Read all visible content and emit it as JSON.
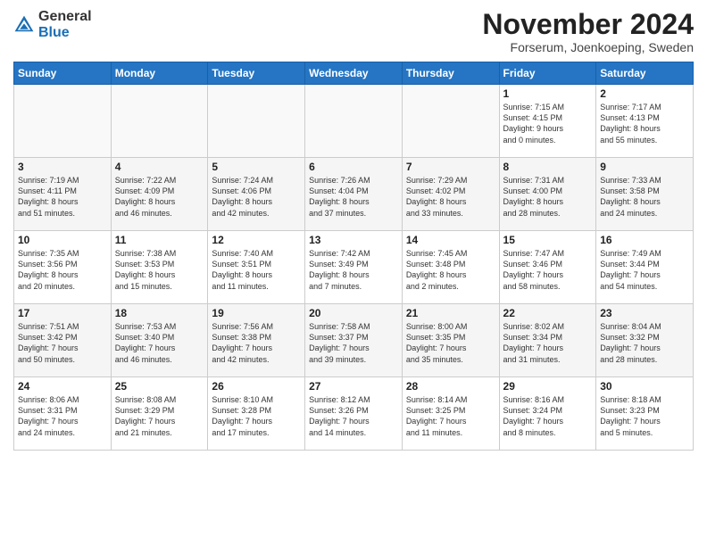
{
  "header": {
    "logo_general": "General",
    "logo_blue": "Blue",
    "month_title": "November 2024",
    "location": "Forserum, Joenkoeping, Sweden"
  },
  "days_of_week": [
    "Sunday",
    "Monday",
    "Tuesday",
    "Wednesday",
    "Thursday",
    "Friday",
    "Saturday"
  ],
  "weeks": [
    [
      {
        "day": "",
        "info": ""
      },
      {
        "day": "",
        "info": ""
      },
      {
        "day": "",
        "info": ""
      },
      {
        "day": "",
        "info": ""
      },
      {
        "day": "",
        "info": ""
      },
      {
        "day": "1",
        "info": "Sunrise: 7:15 AM\nSunset: 4:15 PM\nDaylight: 9 hours\nand 0 minutes."
      },
      {
        "day": "2",
        "info": "Sunrise: 7:17 AM\nSunset: 4:13 PM\nDaylight: 8 hours\nand 55 minutes."
      }
    ],
    [
      {
        "day": "3",
        "info": "Sunrise: 7:19 AM\nSunset: 4:11 PM\nDaylight: 8 hours\nand 51 minutes."
      },
      {
        "day": "4",
        "info": "Sunrise: 7:22 AM\nSunset: 4:09 PM\nDaylight: 8 hours\nand 46 minutes."
      },
      {
        "day": "5",
        "info": "Sunrise: 7:24 AM\nSunset: 4:06 PM\nDaylight: 8 hours\nand 42 minutes."
      },
      {
        "day": "6",
        "info": "Sunrise: 7:26 AM\nSunset: 4:04 PM\nDaylight: 8 hours\nand 37 minutes."
      },
      {
        "day": "7",
        "info": "Sunrise: 7:29 AM\nSunset: 4:02 PM\nDaylight: 8 hours\nand 33 minutes."
      },
      {
        "day": "8",
        "info": "Sunrise: 7:31 AM\nSunset: 4:00 PM\nDaylight: 8 hours\nand 28 minutes."
      },
      {
        "day": "9",
        "info": "Sunrise: 7:33 AM\nSunset: 3:58 PM\nDaylight: 8 hours\nand 24 minutes."
      }
    ],
    [
      {
        "day": "10",
        "info": "Sunrise: 7:35 AM\nSunset: 3:56 PM\nDaylight: 8 hours\nand 20 minutes."
      },
      {
        "day": "11",
        "info": "Sunrise: 7:38 AM\nSunset: 3:53 PM\nDaylight: 8 hours\nand 15 minutes."
      },
      {
        "day": "12",
        "info": "Sunrise: 7:40 AM\nSunset: 3:51 PM\nDaylight: 8 hours\nand 11 minutes."
      },
      {
        "day": "13",
        "info": "Sunrise: 7:42 AM\nSunset: 3:49 PM\nDaylight: 8 hours\nand 7 minutes."
      },
      {
        "day": "14",
        "info": "Sunrise: 7:45 AM\nSunset: 3:48 PM\nDaylight: 8 hours\nand 2 minutes."
      },
      {
        "day": "15",
        "info": "Sunrise: 7:47 AM\nSunset: 3:46 PM\nDaylight: 7 hours\nand 58 minutes."
      },
      {
        "day": "16",
        "info": "Sunrise: 7:49 AM\nSunset: 3:44 PM\nDaylight: 7 hours\nand 54 minutes."
      }
    ],
    [
      {
        "day": "17",
        "info": "Sunrise: 7:51 AM\nSunset: 3:42 PM\nDaylight: 7 hours\nand 50 minutes."
      },
      {
        "day": "18",
        "info": "Sunrise: 7:53 AM\nSunset: 3:40 PM\nDaylight: 7 hours\nand 46 minutes."
      },
      {
        "day": "19",
        "info": "Sunrise: 7:56 AM\nSunset: 3:38 PM\nDaylight: 7 hours\nand 42 minutes."
      },
      {
        "day": "20",
        "info": "Sunrise: 7:58 AM\nSunset: 3:37 PM\nDaylight: 7 hours\nand 39 minutes."
      },
      {
        "day": "21",
        "info": "Sunrise: 8:00 AM\nSunset: 3:35 PM\nDaylight: 7 hours\nand 35 minutes."
      },
      {
        "day": "22",
        "info": "Sunrise: 8:02 AM\nSunset: 3:34 PM\nDaylight: 7 hours\nand 31 minutes."
      },
      {
        "day": "23",
        "info": "Sunrise: 8:04 AM\nSunset: 3:32 PM\nDaylight: 7 hours\nand 28 minutes."
      }
    ],
    [
      {
        "day": "24",
        "info": "Sunrise: 8:06 AM\nSunset: 3:31 PM\nDaylight: 7 hours\nand 24 minutes."
      },
      {
        "day": "25",
        "info": "Sunrise: 8:08 AM\nSunset: 3:29 PM\nDaylight: 7 hours\nand 21 minutes."
      },
      {
        "day": "26",
        "info": "Sunrise: 8:10 AM\nSunset: 3:28 PM\nDaylight: 7 hours\nand 17 minutes."
      },
      {
        "day": "27",
        "info": "Sunrise: 8:12 AM\nSunset: 3:26 PM\nDaylight: 7 hours\nand 14 minutes."
      },
      {
        "day": "28",
        "info": "Sunrise: 8:14 AM\nSunset: 3:25 PM\nDaylight: 7 hours\nand 11 minutes."
      },
      {
        "day": "29",
        "info": "Sunrise: 8:16 AM\nSunset: 3:24 PM\nDaylight: 7 hours\nand 8 minutes."
      },
      {
        "day": "30",
        "info": "Sunrise: 8:18 AM\nSunset: 3:23 PM\nDaylight: 7 hours\nand 5 minutes."
      }
    ]
  ]
}
